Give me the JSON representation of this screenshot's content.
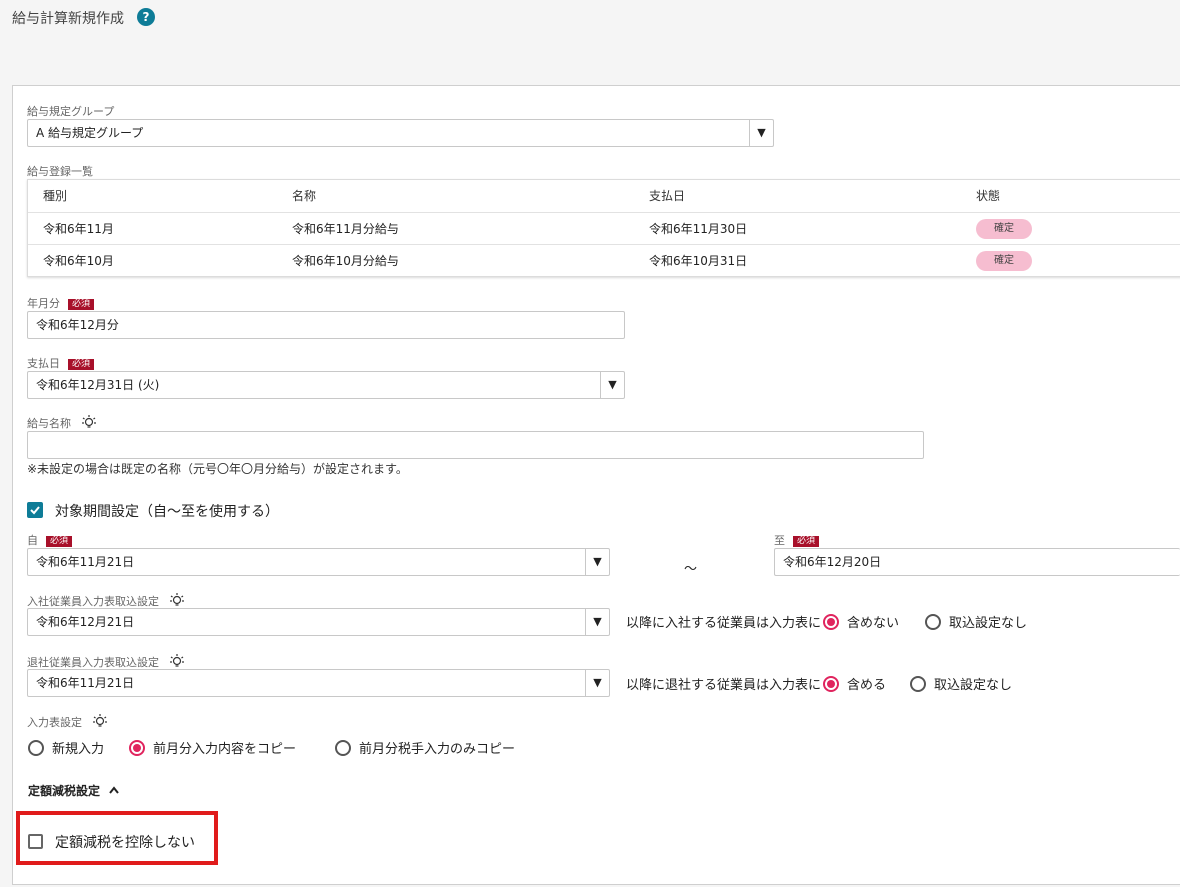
{
  "header": {
    "title": "給与計算新規作成",
    "help": "?"
  },
  "group": {
    "label": "給与規定グループ",
    "value": "A 給与規定グループ"
  },
  "registry": {
    "label": "給与登録一覧",
    "columns": [
      "種別",
      "名称",
      "支払日",
      "状態"
    ],
    "rows": [
      {
        "type": "令和6年11月",
        "name": "令和6年11月分給与",
        "pay_date": "令和6年11月30日",
        "status": "確定"
      },
      {
        "type": "令和6年10月",
        "name": "令和6年10月分給与",
        "pay_date": "令和6年10月31日",
        "status": "確定"
      }
    ]
  },
  "year_month": {
    "label": "年月分",
    "required": "必須",
    "value": "令和6年12月分"
  },
  "pay_day": {
    "label": "支払日",
    "required": "必須",
    "value": "令和6年12月31日 (火)"
  },
  "salary_name": {
    "label": "給与名称",
    "value": "",
    "note": "※未設定の場合は既定の名称（元号〇年〇月分給与）が設定されます。"
  },
  "period": {
    "checkbox_label": "対象期間設定（自～至を使用する）",
    "from_label": "自",
    "from_required": "必須",
    "from_value": "令和6年11月21日",
    "tilde": "～",
    "to_label": "至",
    "to_required": "必須",
    "to_value": "令和6年12月20日"
  },
  "join": {
    "label": "入社従業員入力表取込設定",
    "value": "令和6年12月21日",
    "desc": "以降に入社する従業員は入力表に",
    "opt_on": "含めない",
    "opt_off": "取込設定なし"
  },
  "leave": {
    "label": "退社従業員入力表取込設定",
    "value": "令和6年11月21日",
    "desc": "以降に退社する従業員は入力表に",
    "opt_on": "含める",
    "opt_off": "取込設定なし"
  },
  "input_table": {
    "label": "入力表設定",
    "options": [
      "新規入力",
      "前月分入力内容をコピー",
      "前月分税手入力のみコピー"
    ],
    "selected_index": 1
  },
  "tax_reduction": {
    "section_label": "定額減税設定",
    "checkbox_label": "定額減税を控除しない"
  },
  "colors": {
    "accent": "#0e7c97",
    "radio": "#e0245e",
    "required": "#a8102a",
    "highlight": "#e01b1b"
  }
}
